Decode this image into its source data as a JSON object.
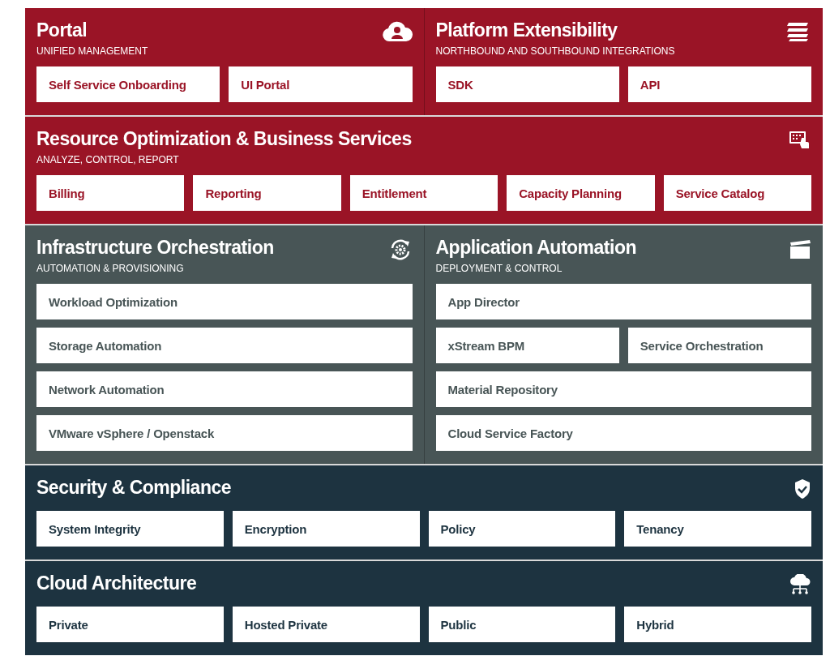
{
  "layers": [
    {
      "panels": [
        {
          "title": "Portal",
          "subtitle": "UNIFIED MANAGEMENT",
          "color": "#9a1426",
          "rows": [
            [
              "Self Service Onboarding",
              "UI Portal"
            ]
          ]
        },
        {
          "title": "Platform Extensibility",
          "subtitle": "NORTHBOUND AND SOUTHBOUND INTEGRATIONS",
          "color": "#9a1426",
          "rows": [
            [
              "SDK",
              "API"
            ]
          ]
        }
      ]
    },
    {
      "panels": [
        {
          "title": "Resource Optimization & Business Services",
          "subtitle": "ANALYZE, CONTROL, REPORT",
          "color": "#9a1426",
          "rows": [
            [
              "Billing",
              "Reporting",
              "Entitlement",
              "Capacity Planning",
              "Service Catalog"
            ]
          ]
        }
      ]
    },
    {
      "panels": [
        {
          "title": "Infrastructure Orchestration",
          "subtitle": "AUTOMATION & PROVISIONING",
          "color": "#485556",
          "rows": [
            [
              "Workload Optimization"
            ],
            [
              "Storage Automation"
            ],
            [
              "Network Automation"
            ],
            [
              "VMware vSphere / Openstack"
            ]
          ]
        },
        {
          "title": "Application Automation",
          "subtitle": "DEPLOYMENT & CONTROL",
          "color": "#485556",
          "rows": [
            [
              "App Director"
            ],
            [
              "xStream BPM",
              "Service Orchestration"
            ],
            [
              "Material Repository"
            ],
            [
              "Cloud Service Factory"
            ]
          ]
        }
      ]
    },
    {
      "panels": [
        {
          "title": "Security & Compliance",
          "color": "#1d3340",
          "rows": [
            [
              "System Integrity",
              "Encryption",
              "Policy",
              "Tenancy"
            ]
          ]
        }
      ]
    },
    {
      "panels": [
        {
          "title": "Cloud Architecture",
          "color": "#1d3340",
          "rows": [
            [
              "Private",
              "Hosted Private",
              "Public",
              "Hybrid"
            ]
          ]
        }
      ]
    }
  ]
}
